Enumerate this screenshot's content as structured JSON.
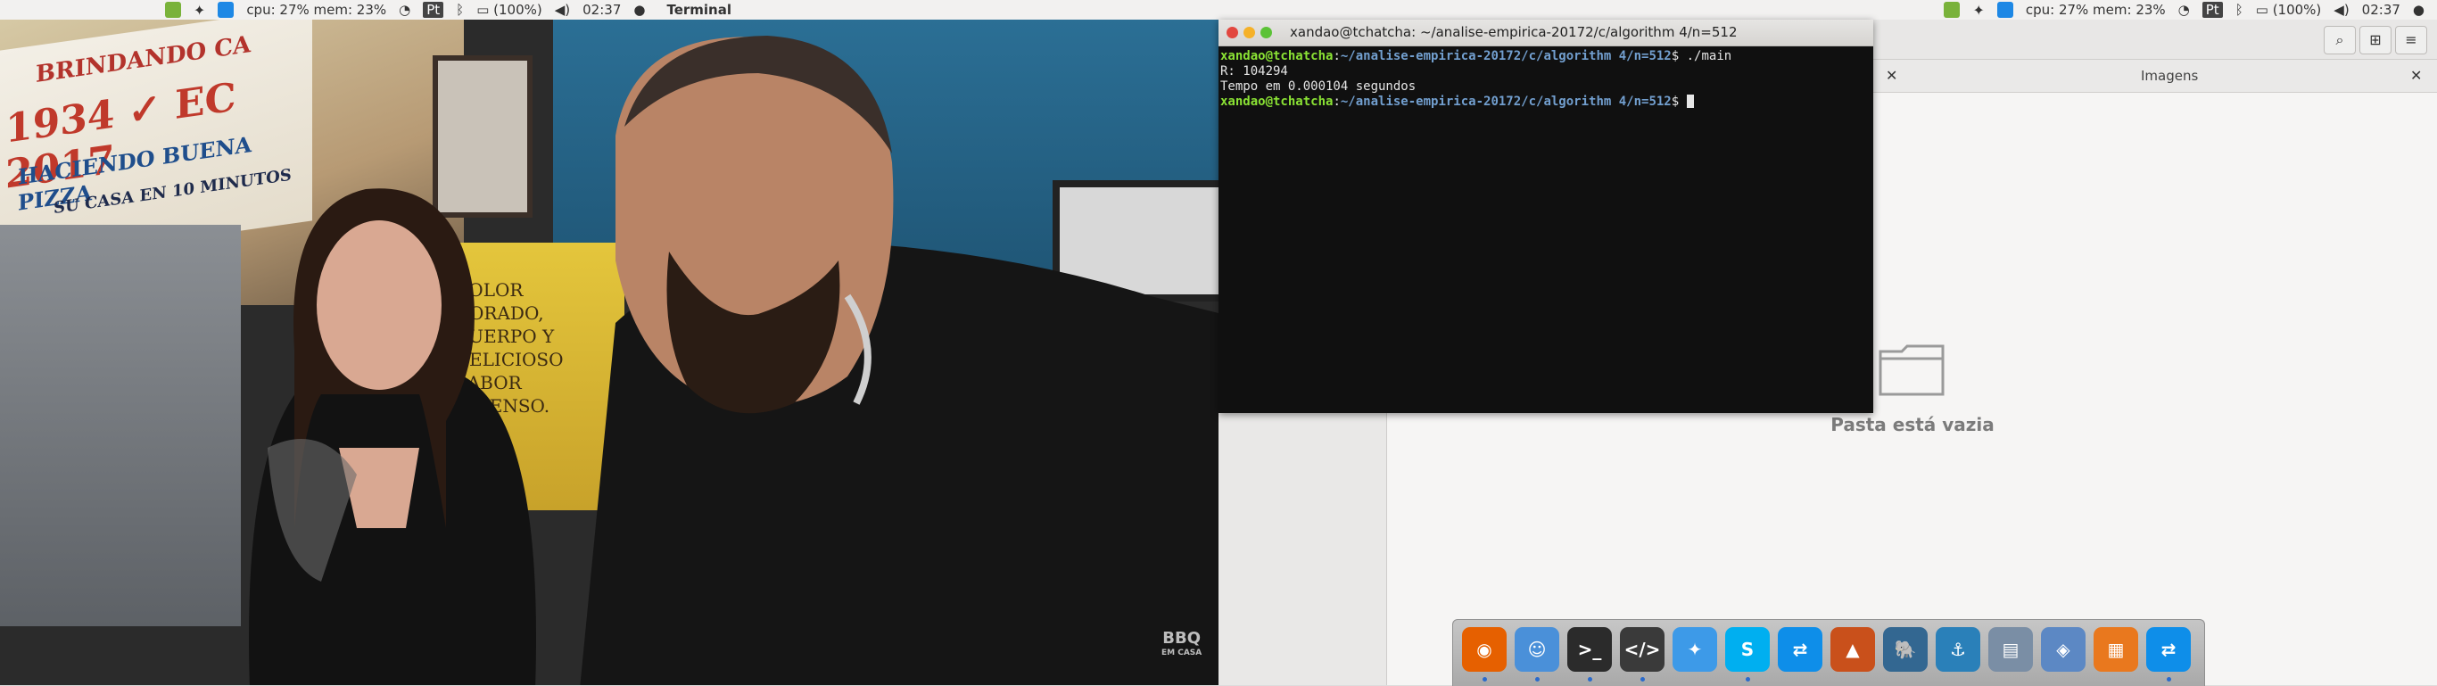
{
  "panel_left": {
    "cpu_mem": "cpu: 27% mem: 23%",
    "input_indicator": "Pt",
    "battery": "(100%)",
    "time": "02:37",
    "app_name": "Terminal"
  },
  "panel_right": {
    "cpu_mem": "cpu: 27% mem: 23%",
    "input_indicator": "Pt",
    "battery": "(100%)",
    "time": "02:37"
  },
  "video": {
    "sign_year": "2017",
    "sign_line1": "BRINDANDO CA",
    "sign_line2": "1934 ✓ EC 2017",
    "sign_line3": "HACIENDO BUENA PIZZA",
    "sign_line4": "SU CASA EN 10 MINUTOS",
    "machine_text": [
      "COLOR",
      "DORADO,",
      "CUERPO Y",
      "DELICIOSO",
      "SABOR",
      "INTENSO."
    ],
    "watermark": "BBQ",
    "watermark_sub": "EM CASA"
  },
  "file_manager": {
    "tab_label": "Imagens",
    "empty_message": "Pasta está vazia"
  },
  "terminal": {
    "title": "xandao@tchatcha: ~/analise-empirica-20172/c/algorithm 4/n=512",
    "lines": [
      {
        "user": "xandao@tchatcha",
        "path": "~/analise-empirica-20172/c/algorithm 4/n=512",
        "cmd": " ./main"
      },
      {
        "text": "R: 104294"
      },
      {
        "text": "Tempo em 0.000104 segundos"
      },
      {
        "user": "xandao@tchatcha",
        "path": "~/analise-empirica-20172/c/algorithm 4/n=512",
        "cmd": " "
      }
    ]
  },
  "dock": {
    "items": [
      {
        "icon": "firefox-icon",
        "color": "#e66000",
        "running": true
      },
      {
        "icon": "finder-icon",
        "color": "#4a90d9",
        "running": true
      },
      {
        "icon": "terminal-icon",
        "color": "#2b2b2b",
        "running": true
      },
      {
        "icon": "code-editor-icon",
        "color": "#3a3a3a",
        "running": true
      },
      {
        "icon": "dropbox-icon",
        "color": "#3d9ae8",
        "running": false
      },
      {
        "icon": "skype-icon",
        "color": "#00aff0",
        "running": true
      },
      {
        "icon": "teamviewer-icon",
        "color": "#0e8ee9",
        "running": false
      },
      {
        "icon": "matlab-icon",
        "color": "#c9501b",
        "running": false
      },
      {
        "icon": "postgresql-icon",
        "color": "#336791",
        "running": false
      },
      {
        "icon": "mysql-workbench-icon",
        "color": "#2a80b9",
        "running": false
      },
      {
        "icon": "scanner-icon",
        "color": "#7a8ea5",
        "running": false
      },
      {
        "icon": "virtualbox-icon",
        "color": "#5c88c4",
        "running": false
      },
      {
        "icon": "ubuntu-software-icon",
        "color": "#e9781e",
        "running": false
      },
      {
        "icon": "teamviewer-icon-2",
        "color": "#0e8ee9",
        "running": true
      }
    ]
  }
}
